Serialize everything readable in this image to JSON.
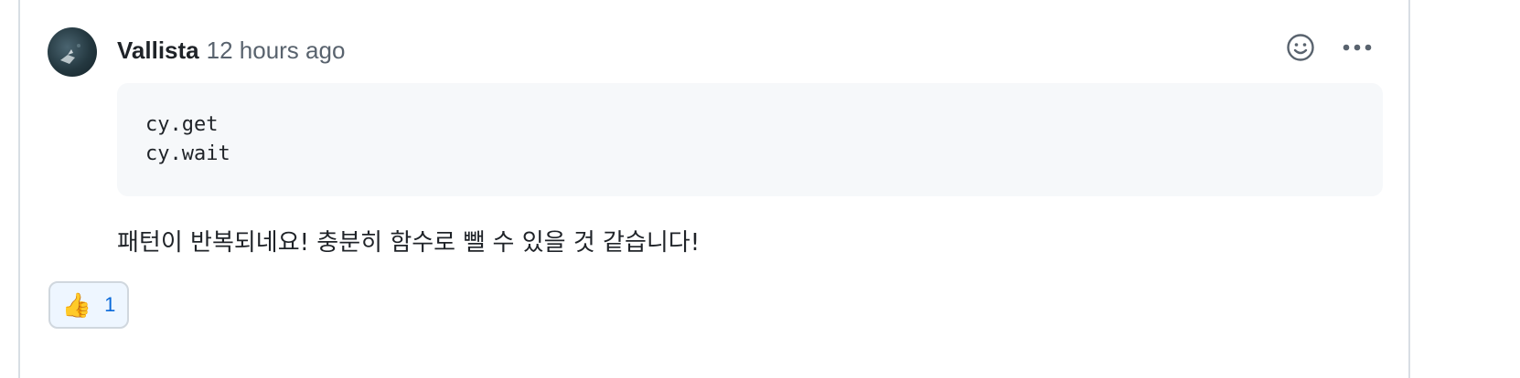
{
  "comment": {
    "author": "Vallista",
    "timestamp": "12 hours ago",
    "code_lines": [
      "cy.get",
      "cy.wait"
    ],
    "body": "패턴이 반복되네요! 충분히 함수로 뺄 수 있을 것 같습니다!",
    "actions": {
      "emoji_icon": "smiley-icon",
      "more_icon": "kebab-horizontal-icon"
    },
    "reactions": [
      {
        "emoji": "👍",
        "icon": "thumbs-up-icon",
        "count": "1"
      }
    ]
  },
  "colors": {
    "text_primary": "#1f2328",
    "text_muted": "#59636e",
    "code_bg": "#f6f8fa",
    "reaction_count": "#0969da",
    "border": "#d0d7de"
  }
}
